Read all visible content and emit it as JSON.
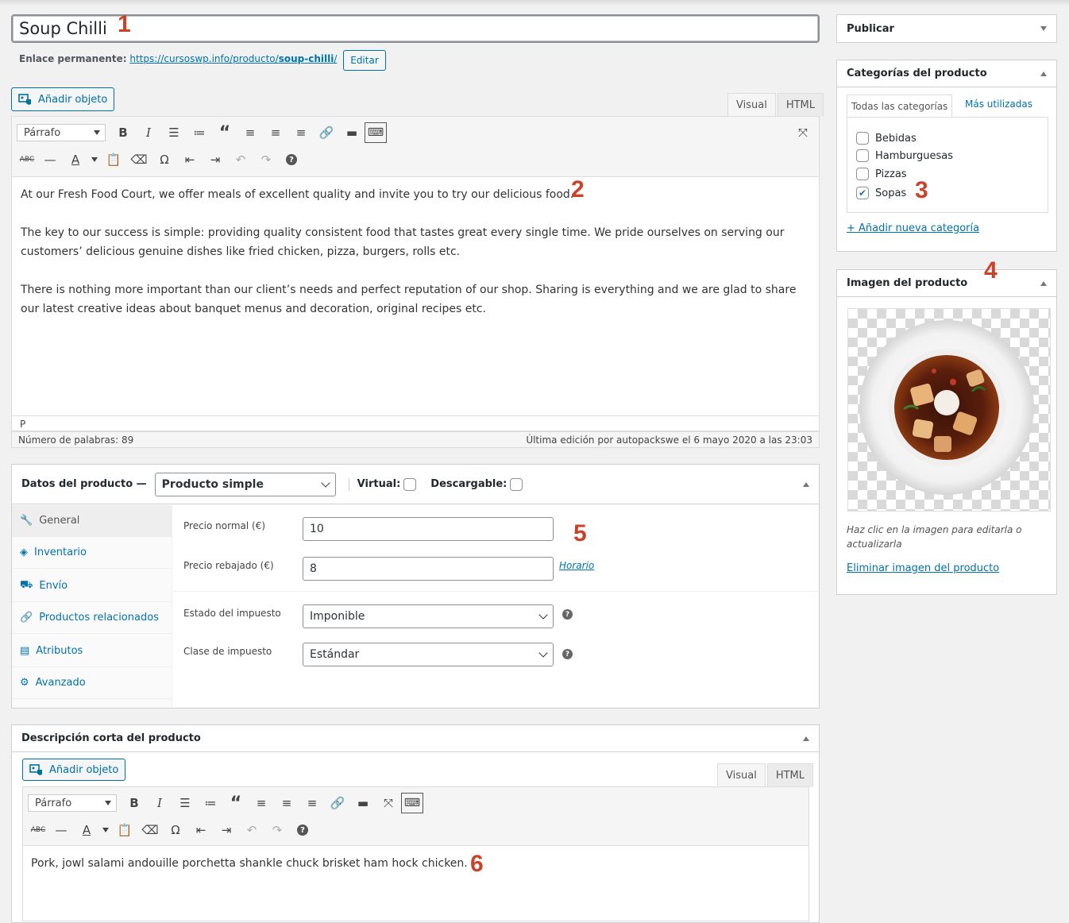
{
  "product": {
    "title": "Soup Chilli",
    "permalink_label": "Enlace permanente:",
    "permalink_base": "https://cursoswp.info/producto/",
    "permalink_slug": "soup-chilli",
    "permalink_end": "/",
    "edit_label": "Editar"
  },
  "annotations": [
    "1",
    "2",
    "3",
    "4",
    "5",
    "6"
  ],
  "editor": {
    "add_media": "Añadir objeto",
    "tab_visual": "Visual",
    "tab_html": "HTML",
    "format": "Párrafo",
    "paragraphs": [
      "At our Fresh Food Court, we offer meals of excellent quality and invite you to try our delicious food.",
      "The key to our success is simple: providing quality consistent food that tastes great every single time. We pride ourselves on serving our customers’ delicious genuine dishes like fried chicken, pizza, burgers, rolls etc.",
      "There is nothing more important than our client’s needs and perfect reputation of our shop. Sharing is everything and we are glad to share our latest creative ideas about banquet menus and decoration, original recipes etc."
    ],
    "path": "P",
    "word_count": "Número de palabras: 89",
    "last_edit": "Última edición por autopackswe el 6 mayo 2020 a las 23:03"
  },
  "product_data": {
    "label": "Datos del producto —",
    "type": "Producto simple",
    "virtual_label": "Virtual:",
    "downloadable_label": "Descargable:",
    "tabs": [
      "General",
      "Inventario",
      "Envío",
      "Productos relacionados",
      "Atributos",
      "Avanzado"
    ],
    "regular_price_label": "Precio normal (€)",
    "regular_price": "10",
    "sale_price_label": "Precio rebajado (€)",
    "sale_price": "8",
    "schedule_link": "Horario",
    "tax_status_label": "Estado del impuesto",
    "tax_status": "Imponible",
    "tax_class_label": "Clase de impuesto",
    "tax_class": "Estándar"
  },
  "short_description": {
    "title": "Descripción corta del producto",
    "add_media": "Añadir objeto",
    "tab_visual": "Visual",
    "tab_html": "HTML",
    "format": "Párrafo",
    "text": "Pork, jowl salami andouille porchetta shankle chuck brisket ham hock chicken."
  },
  "sidebar": {
    "publish_title": "Publicar",
    "categories_title": "Categorías del producto",
    "cat_tab_all": "Todas las categorías",
    "cat_tab_most": "Más utilizadas",
    "categories": [
      {
        "name": "Bebidas",
        "checked": false
      },
      {
        "name": "Hamburguesas",
        "checked": false
      },
      {
        "name": "Pizzas",
        "checked": false
      },
      {
        "name": "Sopas",
        "checked": true
      }
    ],
    "add_category": "+ Añadir nueva categoría",
    "image_title": "Imagen del producto",
    "image_hint": "Haz clic en la imagen para editarla o actualizarla",
    "remove_image": "Eliminar imagen del producto"
  },
  "colors": {
    "accent": "#0073aa",
    "annotation": "#c9432a"
  }
}
